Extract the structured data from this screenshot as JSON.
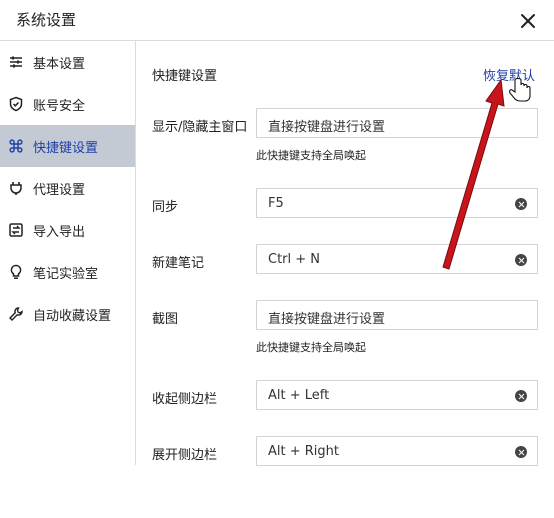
{
  "window": {
    "title": "系统设置"
  },
  "sidebar": {
    "items": [
      {
        "label": "基本设置"
      },
      {
        "label": "账号安全"
      },
      {
        "label": "快捷键设置"
      },
      {
        "label": "代理设置"
      },
      {
        "label": "导入导出"
      },
      {
        "label": "笔记实验室"
      },
      {
        "label": "自动收藏设置"
      }
    ],
    "active_index": 2
  },
  "main": {
    "section_title": "快捷键设置",
    "restore_label": "恢复默认",
    "rows": [
      {
        "label": "显示/隐藏主窗口",
        "placeholder": "直接按键盘进行设置",
        "hint": "此快捷键支持全局唤起"
      },
      {
        "label": "同步",
        "value": "F5"
      },
      {
        "label": "新建笔记",
        "value": "Ctrl + N"
      },
      {
        "label": "截图",
        "placeholder": "直接按键盘进行设置",
        "hint": "此快捷键支持全局唤起"
      },
      {
        "label": "收起侧边栏",
        "value": "Alt + Left"
      },
      {
        "label": "展开侧边栏",
        "value": "Alt + Right"
      }
    ]
  },
  "colors": {
    "accent": "#1e3fa8",
    "active_bg": "#c4cad3",
    "annotation_arrow": "#c8141b"
  },
  "icons": [
    "sliders-icon",
    "shield-icon",
    "command-icon",
    "plug-icon",
    "swap-icon",
    "lightbulb-icon",
    "wrench-icon",
    "close-icon",
    "hand-cursor-icon"
  ]
}
